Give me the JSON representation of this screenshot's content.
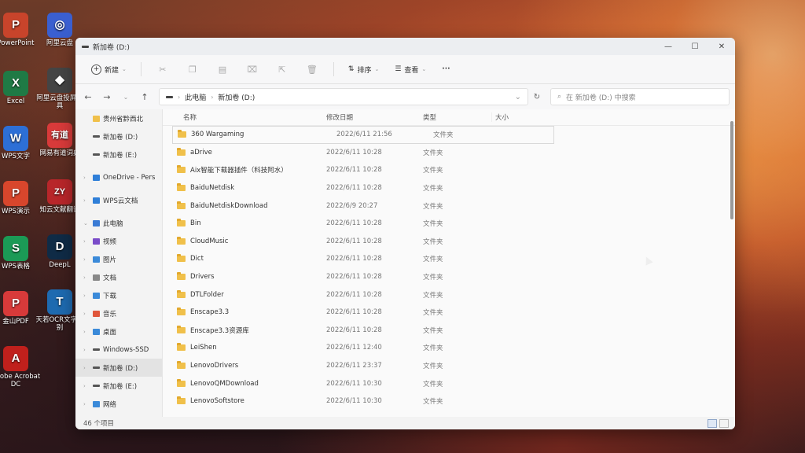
{
  "desktop": {
    "icons": [
      {
        "label": "PowerPoint",
        "color": "#c8442b",
        "glyph": "P"
      },
      {
        "label": "Excel",
        "color": "#1f7a45",
        "glyph": "X"
      },
      {
        "label": "WPS文字",
        "color": "#2d6fd6",
        "glyph": "W"
      },
      {
        "label": "WPS演示",
        "color": "#d8462c",
        "glyph": "P"
      },
      {
        "label": "WPS表格",
        "color": "#1b9a56",
        "glyph": "S"
      },
      {
        "label": "金山PDF",
        "color": "#d83a3a",
        "glyph": "P"
      },
      {
        "label": "Adobe Acrobat DC",
        "color": "#c0201c",
        "glyph": "A"
      }
    ],
    "icons2": [
      {
        "label": "阿里云盘",
        "color": "#3a5fd0",
        "glyph": "◎"
      },
      {
        "label": "阿里云盘投屏工具",
        "color": "#444",
        "glyph": "◆"
      },
      {
        "label": "网易有道词典",
        "color": "#d83a3a",
        "glyph": "有道"
      },
      {
        "label": "知云文献翻译",
        "color": "#b8262a",
        "glyph": "ZY"
      },
      {
        "label": "DeepL",
        "color": "#0f2b46",
        "glyph": "D"
      },
      {
        "label": "天若OCR文字识别",
        "color": "#1e6ab0",
        "glyph": "T"
      }
    ]
  },
  "window": {
    "title": "新加卷 (D:)",
    "controls": {
      "minimize": "—",
      "maximize": "☐",
      "close": "✕"
    }
  },
  "toolbar": {
    "new_label": "新建",
    "sort_label": "排序",
    "view_label": "查看",
    "more_label": "···"
  },
  "address": {
    "crumbs": [
      "此电脑",
      "新加卷 (D:)"
    ],
    "search_placeholder": "在 新加卷 (D:) 中搜索"
  },
  "sidebar": {
    "items": [
      {
        "label": "贵州省黔西北",
        "icon": "folder"
      },
      {
        "label": "新加卷 (D:)",
        "icon": "drive"
      },
      {
        "label": "新加卷 (E:)",
        "icon": "drive"
      },
      {
        "label": "OneDrive - Pers",
        "icon": "cloud"
      },
      {
        "label": "WPS云文档",
        "icon": "cloud"
      },
      {
        "label": "此电脑",
        "icon": "pc"
      },
      {
        "label": "视频",
        "icon": "video"
      },
      {
        "label": "图片",
        "icon": "picture"
      },
      {
        "label": "文档",
        "icon": "document"
      },
      {
        "label": "下载",
        "icon": "download"
      },
      {
        "label": "音乐",
        "icon": "music"
      },
      {
        "label": "桌面",
        "icon": "desktop"
      },
      {
        "label": "Windows-SSD",
        "icon": "drive"
      },
      {
        "label": "新加卷 (D:)",
        "icon": "drive"
      },
      {
        "label": "新加卷 (E:)",
        "icon": "drive"
      },
      {
        "label": "网络",
        "icon": "network"
      }
    ]
  },
  "columns": {
    "name": "名称",
    "date": "修改日期",
    "type": "类型",
    "size": "大小"
  },
  "files": [
    {
      "name": "360 Wargaming",
      "date": "2022/6/11 21:56",
      "type": "文件夹"
    },
    {
      "name": "aDrive",
      "date": "2022/6/11 10:28",
      "type": "文件夹"
    },
    {
      "name": "Aix智能下载器插件（科技阿水）",
      "date": "2022/6/11 10:28",
      "type": "文件夹"
    },
    {
      "name": "BaiduNetdisk",
      "date": "2022/6/11 10:28",
      "type": "文件夹"
    },
    {
      "name": "BaiduNetdiskDownload",
      "date": "2022/6/9 20:27",
      "type": "文件夹"
    },
    {
      "name": "Bin",
      "date": "2022/6/11 10:28",
      "type": "文件夹"
    },
    {
      "name": "CloudMusic",
      "date": "2022/6/11 10:28",
      "type": "文件夹"
    },
    {
      "name": "Dict",
      "date": "2022/6/11 10:28",
      "type": "文件夹"
    },
    {
      "name": "Drivers",
      "date": "2022/6/11 10:28",
      "type": "文件夹"
    },
    {
      "name": "DTLFolder",
      "date": "2022/6/11 10:28",
      "type": "文件夹"
    },
    {
      "name": "Enscape3.3",
      "date": "2022/6/11 10:28",
      "type": "文件夹"
    },
    {
      "name": "Enscape3.3资源库",
      "date": "2022/6/11 10:28",
      "type": "文件夹"
    },
    {
      "name": "LeiShen",
      "date": "2022/6/11 12:40",
      "type": "文件夹"
    },
    {
      "name": "LenovoDrivers",
      "date": "2022/6/11 23:37",
      "type": "文件夹"
    },
    {
      "name": "LenovoQMDownload",
      "date": "2022/6/11 10:30",
      "type": "文件夹"
    },
    {
      "name": "LenovoSoftstore",
      "date": "2022/6/11 10:30",
      "type": "文件夹"
    }
  ],
  "status": {
    "count": "46 个项目"
  }
}
